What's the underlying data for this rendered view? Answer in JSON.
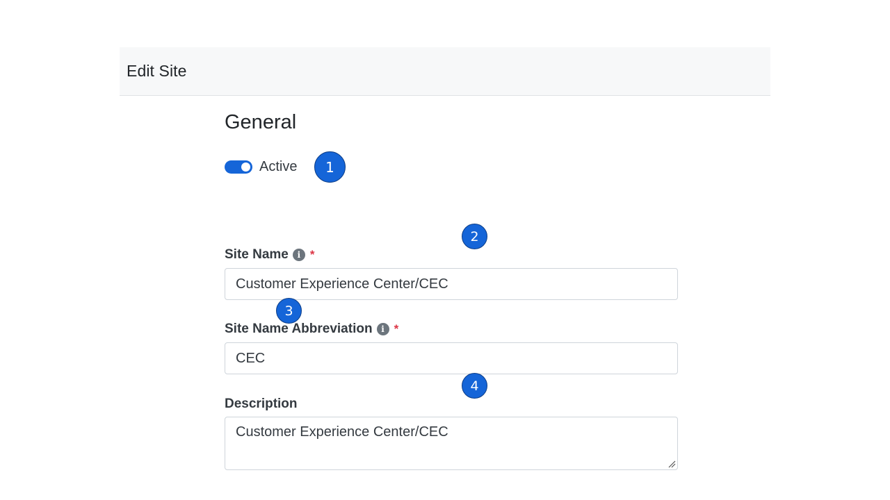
{
  "panel": {
    "title": "Edit Site"
  },
  "section": {
    "title": "General"
  },
  "active_toggle": {
    "label": "Active",
    "checked": true,
    "color": "#1565d8"
  },
  "fields": {
    "site_name": {
      "label": "Site Name",
      "info_icon": "info-icon",
      "required_marker": "*",
      "value": "Customer Experience Center/CEC"
    },
    "site_abbreviation": {
      "label": "Site Name Abbreviation",
      "info_icon": "info-icon",
      "required_marker": "*",
      "value": "CEC"
    },
    "description": {
      "label": "Description",
      "value": "Customer Experience Center/CEC"
    }
  },
  "callouts": [
    "1",
    "2",
    "3",
    "4"
  ],
  "colors": {
    "accent": "#1565d8",
    "required": "#dc3545",
    "header_bg": "#f7f8f9"
  }
}
